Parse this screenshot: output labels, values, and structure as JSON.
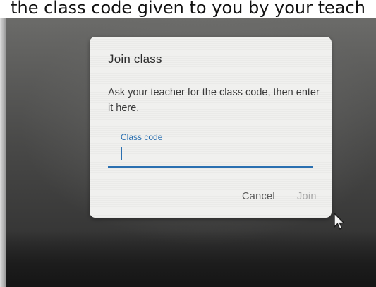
{
  "caption": "the class code given to you by your teach",
  "dialog": {
    "title": "Join class",
    "description": "Ask your teacher for the class code, then enter it here.",
    "field": {
      "label": "Class code",
      "value": ""
    },
    "cancel_label": "Cancel",
    "join_label": "Join"
  },
  "colors": {
    "accent": "#2a6fb0",
    "disabled": "#a8a8a8"
  },
  "icons": {
    "pointer": "mouse-pointer-icon"
  }
}
